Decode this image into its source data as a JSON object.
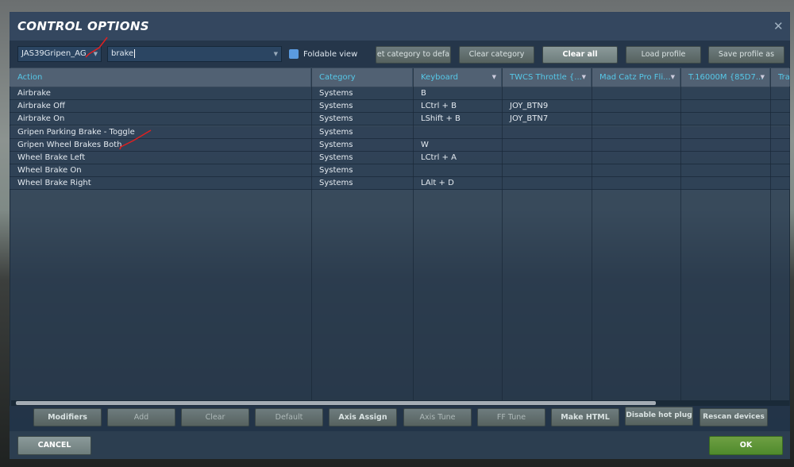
{
  "window": {
    "title": "CONTROL OPTIONS",
    "close_icon": "close-icon"
  },
  "toolbar": {
    "aircraft_select": "JAS39Gripen_AG",
    "search_value": "brake",
    "foldable_view_label": "Foldable view",
    "foldable_view_checked": false,
    "buttons": [
      "Reset category to default",
      "Clear category",
      "Clear all",
      "Load profile",
      "Save profile as"
    ],
    "reset_visible": "et category to defa"
  },
  "table": {
    "columns": [
      "Action",
      "Category",
      "Keyboard",
      "TWCS Throttle {...",
      "Mad Catz Pro Fli...",
      "T.16000M {85D7...",
      "Tra"
    ],
    "rows": [
      [
        "Airbrake",
        "Systems",
        "B",
        "",
        "",
        "",
        ""
      ],
      [
        "Airbrake Off",
        "Systems",
        "LCtrl + B",
        "JOY_BTN9",
        "",
        "",
        ""
      ],
      [
        "Airbrake On",
        "Systems",
        "LShift + B",
        "JOY_BTN7",
        "",
        "",
        ""
      ],
      [
        "Gripen Parking Brake - Toggle",
        "Systems",
        "",
        "",
        "",
        "",
        ""
      ],
      [
        "Gripen Wheel Brakes Both",
        "Systems",
        "W",
        "",
        "",
        "",
        ""
      ],
      [
        "Wheel Brake Left",
        "Systems",
        "LCtrl + A",
        "",
        "",
        "",
        ""
      ],
      [
        "Wheel Brake On",
        "Systems",
        "",
        "",
        "",
        "",
        ""
      ],
      [
        "Wheel Brake Right",
        "Systems",
        "LAlt + D",
        "",
        "",
        "",
        ""
      ]
    ]
  },
  "bottom_buttons": [
    "Modifiers",
    "Add",
    "Clear",
    "Default",
    "Axis Assign",
    "Axis Tune",
    "FF Tune",
    "Make HTML",
    "Disable hot plug",
    "Rescan devices"
  ],
  "footer": {
    "cancel": "CANCEL",
    "ok": "OK"
  },
  "colors": {
    "header_text": "#56c8e8",
    "ok_green": "#5a9435",
    "annotation": "#e02020"
  }
}
